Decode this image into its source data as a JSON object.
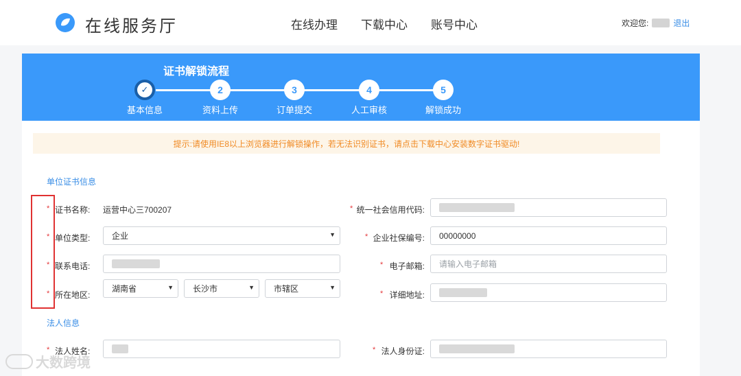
{
  "header": {
    "brand": "在线服务厅",
    "nav": [
      "在线办理",
      "下载中心",
      "账号中心"
    ],
    "welcome": "欢迎您:",
    "logout": "退出",
    "colors": {
      "accent": "#3a99fa",
      "link": "#3a8ee6"
    }
  },
  "flow": {
    "title": "证书解锁流程",
    "steps": [
      {
        "num": "✓",
        "label": "基本信息"
      },
      {
        "num": "2",
        "label": "资料上传"
      },
      {
        "num": "3",
        "label": "订单提交"
      },
      {
        "num": "4",
        "label": "人工审核"
      },
      {
        "num": "5",
        "label": "解锁成功"
      }
    ]
  },
  "notice": "提示:请使用IE8以上浏览器进行解锁操作，若无法识别证书，请点击下载中心安装数字证书驱动!",
  "unit": {
    "title": "单位证书信息",
    "cert_name_label": "证书名称:",
    "cert_name_value": "运营中心三700207",
    "credit_code_label": "统一社会信用代码:",
    "unit_type_label": "单位类型:",
    "unit_type_value": "企业",
    "social_no_label": "企业社保编号:",
    "social_no_value": "00000000",
    "phone_label": "联系电话:",
    "email_label": "电子邮箱:",
    "email_placeholder": "请输入电子邮箱",
    "region_label": "所在地区:",
    "province": "湖南省",
    "city": "长沙市",
    "district": "市辖区",
    "address_label": "详细地址:"
  },
  "legal": {
    "title": "法人信息",
    "name_label": "法人姓名:",
    "id_label": "法人身份证:"
  },
  "required_mark": "*",
  "watermark": "大数跨境"
}
